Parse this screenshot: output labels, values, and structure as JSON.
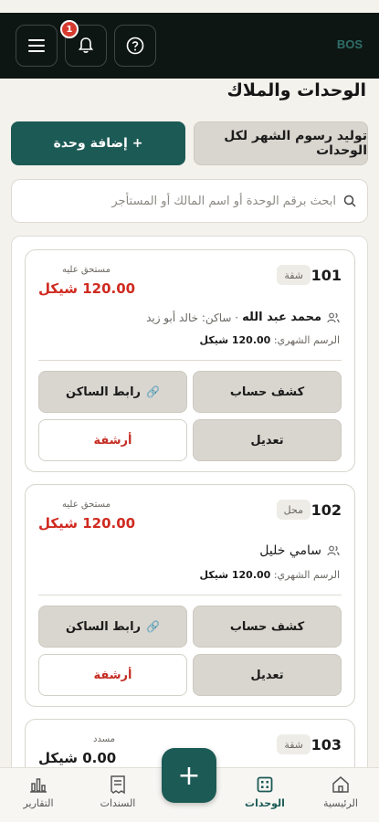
{
  "header": {
    "brand": "BOS",
    "notification_count": "1"
  },
  "page": {
    "title": "الوحدات والملاك",
    "generate_button": "توليد رسوم الشهر لكل الوحدات",
    "add_button": "+ إضافة وحدة",
    "search_placeholder": "ابحث برقم الوحدة أو اسم المالك أو المستأجر"
  },
  "units": [
    {
      "number": "101",
      "type": "شقة",
      "balance_label": "مستحق عليه",
      "balance": "120.00 شيكل",
      "owner": "محمد عبد الله",
      "resident": "· ساكن: خالد أبو زيد",
      "fee_label": "الرسم الشهري:",
      "fee": "120.00 شيكل",
      "statement_button": "كشف حساب",
      "resident_link_button": "رابط الساكن",
      "edit_button": "تعديل",
      "archive_button": "أرشفة"
    },
    {
      "number": "102",
      "type": "محل",
      "balance_label": "مستحق عليه",
      "balance": "120.00 شيكل",
      "owner": "سامي خليل",
      "resident": "",
      "fee_label": "الرسم الشهري:",
      "fee": "120.00 شيكل",
      "statement_button": "كشف حساب",
      "resident_link_button": "رابط الساكن",
      "edit_button": "تعديل",
      "archive_button": "أرشفة"
    },
    {
      "number": "103",
      "type": "شقة",
      "balance_label": "مسدد",
      "balance": "0.00 شيكل"
    }
  ],
  "nav": {
    "home": "الرئيسية",
    "units": "الوحدات",
    "fab": "+",
    "receipts": "السندات",
    "reports": "التقارير"
  },
  "colors": {
    "primary": "#1c5a55",
    "debt": "#d02a20",
    "paid": "#1b1b1b",
    "topbar": "#0e1614"
  }
}
